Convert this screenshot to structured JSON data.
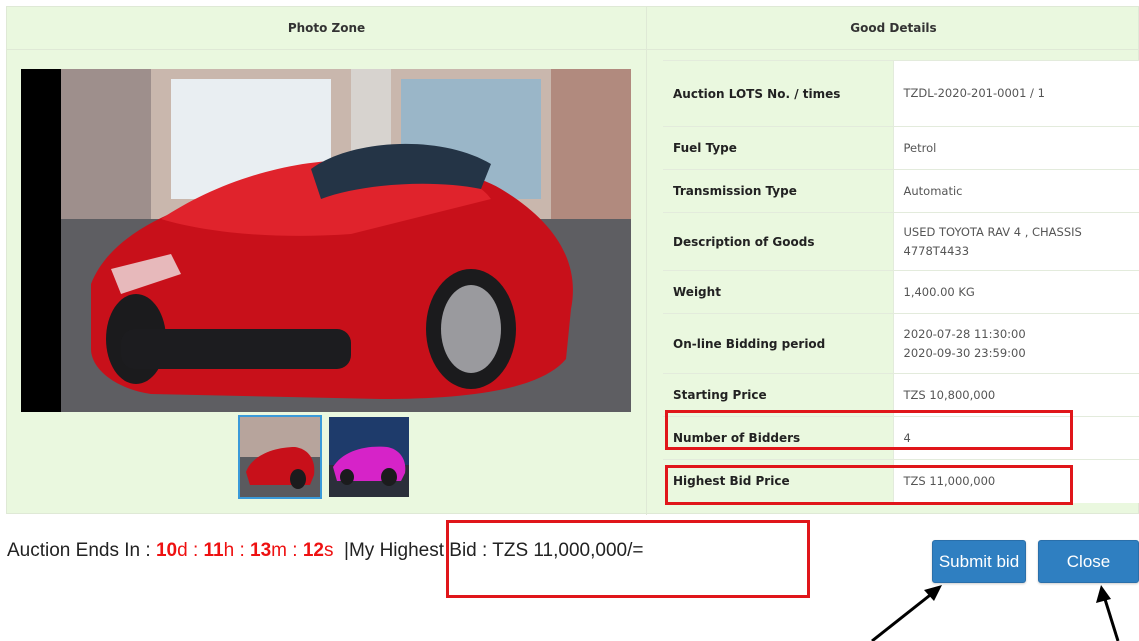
{
  "headers": {
    "photo_zone": "Photo Zone",
    "good_details": "Good Details"
  },
  "details": [
    {
      "label": "Auction LOTS No. / times",
      "value": "TZDL-2020-201-0001 / 1"
    },
    {
      "label": "Fuel Type",
      "value": "Petrol"
    },
    {
      "label": "Transmission Type",
      "value": "Automatic"
    },
    {
      "label": "Description of Goods",
      "value": "USED TOYOTA RAV 4 , CHASSIS 4778T4433"
    },
    {
      "label": "Weight",
      "value": "1,400.00 KG"
    },
    {
      "label": "On-line Bidding period",
      "value_start": "2020-07-28 11:30:00",
      "value_end": "2020-09-30 23:59:00"
    },
    {
      "label": "Starting Price",
      "value": "TZS 10,800,000"
    },
    {
      "label": "Number of Bidders",
      "value": "4"
    },
    {
      "label": "Highest Bid Price",
      "value": "TZS 11,000,000"
    }
  ],
  "status": {
    "ends_label": "Auction Ends In :",
    "days": "10",
    "days_unit": "d",
    "hours": "11",
    "hours_unit": "h",
    "minutes": "13",
    "minutes_unit": "m",
    "seconds": "12",
    "seconds_unit": "s",
    "separator": ":",
    "pipe": "|",
    "my_highest_bid": "My Highest Bid : TZS 11,000,000/="
  },
  "buttons": {
    "submit": "Submit bid",
    "close": "Close"
  },
  "colors": {
    "accent": "#2f7fc1",
    "panel": "#eaf8df",
    "highlight": "#e0161a",
    "countdown": "#ee1111"
  }
}
